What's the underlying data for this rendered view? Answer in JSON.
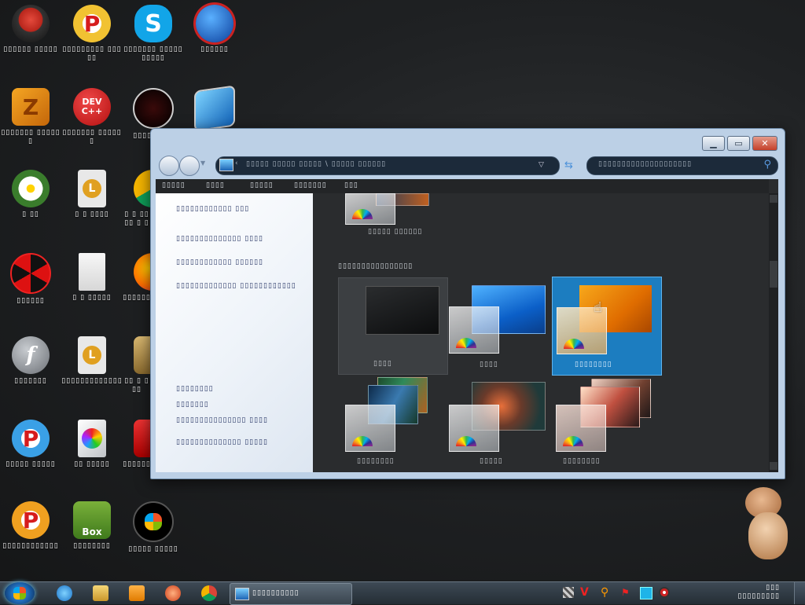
{
  "desktop_icons": [
    {
      "label": "▯▯▯▯▯▯ ▯▯▯▯▯",
      "icon": "cauldron-icon"
    },
    {
      "label": "▯▯▯▯▯▯▯▯▯ ▯▯▯▯▯",
      "icon": "p-app-icon"
    },
    {
      "label": "▯▯▯▯▯▯▯ ▯▯▯▯▯▯▯▯▯▯",
      "icon": "skype-icon"
    },
    {
      "label": "▯▯▯▯▯▯",
      "icon": "globe-icon"
    },
    {
      "label": "▯▯▯▯▯▯▯ ▯▯▯▯▯▯",
      "icon": "z-app-icon"
    },
    {
      "label": "▯▯▯▯▯▯▯ ▯▯▯▯▯▯",
      "icon": "dev-cpp-icon",
      "text": "DEV C++"
    },
    {
      "label": "▯▯▯▯ ▯▯▯▯",
      "icon": "red-round-icon"
    },
    {
      "label": "",
      "icon": "monitor-icon"
    },
    {
      "label": "▯ ▯▯",
      "icon": "flower-icon"
    },
    {
      "label": "▯ ▯ ▯▯▯▯",
      "icon": "l-file-icon"
    },
    {
      "label": "▯ ▯ ▯▯ ▯▯ ▯ ▯",
      "icon": "chrome-icon"
    },
    {
      "label": "▯▯▯▯▯▯",
      "icon": "radiation-icon"
    },
    {
      "label": "▯ ▯ ▯▯▯▯▯",
      "icon": "document-icon"
    },
    {
      "label": "▯▯▯▯▯▯",
      "icon": "firefox-icon"
    },
    {
      "label": "▯▯▯▯▯▯▯",
      "icon": "flash-icon"
    },
    {
      "label": "▯▯▯▯▯▯▯▯▯▯▯▯▯",
      "icon": "l-file-icon-2"
    },
    {
      "label": "▯▯ ▯ ▯ ▯▯",
      "icon": "game-icon"
    },
    {
      "label": "▯▯▯▯▯ ▯▯▯▯▯",
      "icon": "p-app-icon-2"
    },
    {
      "label": "▯▯ ▯▯▯▯▯",
      "icon": "disc-icon"
    },
    {
      "label": "▯▯▯▯▯▯",
      "icon": "pdf-icon"
    },
    {
      "label": "▯▯▯▯▯▯▯▯▯▯▯▯",
      "icon": "p-app-icon-3"
    },
    {
      "label": "▯▯▯▯▯▯▯▯",
      "icon": "box-icon",
      "text": "Box"
    },
    {
      "label": "▯▯▯▯▯ ▯▯▯▯▯",
      "icon": "windows-orb-icon"
    }
  ],
  "window": {
    "address": "▯▯▯▯▯ ▯▯▯▯▯ ▯▯▯▯▯ \\ ▯▯▯▯▯ ▯▯▯▯▯▯",
    "search_placeholder": "▯▯▯▯▯▯▯▯▯▯▯▯▯▯▯▯▯▯▯▯",
    "menu": [
      "▯▯▯▯▯",
      "▯▯▯▯",
      "▯▯▯▯▯",
      "▯▯▯▯▯▯▯",
      "▯▯▯"
    ],
    "left_links": [
      "▯▯▯▯▯▯▯▯▯▯▯▯ ▯▯▯",
      "▯▯▯▯▯▯▯▯▯▯▯▯▯▯ ▯▯▯▯",
      "▯▯▯▯▯▯▯▯▯▯▯▯ ▯▯▯▯▯▯",
      "▯▯▯▯▯▯▯▯▯▯▯▯▯ ▯▯▯▯▯▯▯▯▯▯▯▯"
    ],
    "see_also": [
      "▯▯▯▯▯▯▯▯",
      "▯▯▯▯▯▯▯",
      "▯▯▯▯▯▯▯▯▯▯▯▯▯▯▯ ▯▯▯▯",
      "▯▯▯▯▯▯▯▯▯▯▯▯▯▯ ▯▯▯▯▯"
    ],
    "top_theme_label": "▯▯▯▯▯ ▯▯▯▯▯▯",
    "section_heading": "▯▯▯▯▯▯▯▯▯▯▯▯▯▯▯▯",
    "row1": [
      "▯▯▯▯",
      "▯▯▯▯",
      "▯▯▯▯▯▯▯▯"
    ],
    "row2": [
      "▯▯▯▯▯▯▯▯",
      "▯▯▯▯▯",
      "▯▯▯▯▯▯▯▯"
    ]
  },
  "taskbar": {
    "task_label": "▯▯▯▯▯▯▯▯▯▯",
    "clock_line1": "▯▯▯",
    "clock_line2": "▯▯▯▯▯▯▯▯▯"
  }
}
